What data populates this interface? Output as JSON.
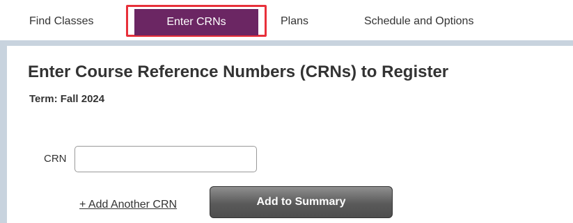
{
  "tabs": {
    "find_classes": "Find Classes",
    "enter_crns": "Enter CRNs",
    "plans": "Plans",
    "schedule_and_options": "Schedule and Options",
    "active": "Enter CRNs",
    "active_color": "#6b2663",
    "highlight_color": "#e8303a"
  },
  "main": {
    "title": "Enter Course Reference Numbers (CRNs) to Register",
    "term_label": "Term: Fall 2024",
    "crn_label": "CRN",
    "crn_value": "",
    "add_link": "+ Add Another CRN",
    "add_button": "Add to Summary"
  }
}
